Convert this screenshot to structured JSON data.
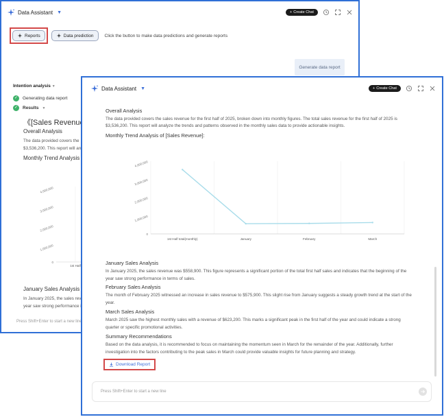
{
  "back": {
    "title": "Data Assistant",
    "create_chat": "Create Chat",
    "reports_button": "Reports",
    "prediction_button": "Data prediction",
    "hint": "Click the button to make data predictions and generate reports",
    "generate_button": "Generate data report",
    "intention_label": "Intention analysis",
    "step_generating": "Generating data report",
    "step_results": "Results",
    "report_title": "《[Sales Revenue] Da",
    "overall_heading": "Overall Analysis",
    "overall_line1": "The data provided covers the",
    "overall_line2": "$3,536,200. This report will an",
    "trend_heading": "Monthly Trend Analysis of",
    "y_ticks": [
      "4,000,000",
      "3,000,000",
      "2,000,000",
      "1,000,000",
      "0"
    ],
    "x_tick": "1st Half",
    "jan_heading": "January Sales Analysis",
    "jan_line1": "In January 2025, the sales reve",
    "jan_line2": "year saw strong performance i",
    "input_placeholder": "Press Shift+Enter to start a new line"
  },
  "front": {
    "title": "Data Assistant",
    "create_chat": "Create Chat",
    "overall_heading": "Overall Analysis",
    "overall_line1": "The data provided covers the sales revenue for the first half of 2025, broken down into monthly figures. The total sales revenue for the first half of 2025 is",
    "overall_line2": "$3,536,200. This report will analyze the trends and patterns observed in the monthly sales data to provide actionable insights.",
    "trend_heading": "Monthly Trend Analysis of [Sales Revenue]:",
    "jan_heading": "January Sales Analysis",
    "jan_line1": "In January 2025, the sales revenue was $558,900. This figure represents a significant portion of the total first half sales and indicates that the beginning of the",
    "jan_line2": "year saw strong performance in terms of sales.",
    "feb_heading": "February Sales Analysis",
    "feb_line1": "The month of February 2025 witnessed an increase in sales revenue to $575,900. This slight rise from January suggests a steady growth trend at the start of the",
    "feb_line2": "year.",
    "mar_heading": "March Sales Analysis",
    "mar_line1": "March 2025 saw the highest monthly sales with a revenue of $623,200. This marks a significant peak in the first half of the year and could indicate a strong",
    "mar_line2": "quarter or specific promotional activities.",
    "sum_heading": "Summary Recommendations",
    "sum_line1": "Based on the data analysis, it is recommended to focus on maintaining the momentum seen in March for the remainder of the year. Additionally, further",
    "sum_line2": "investigation into the factors contributing to the peak sales in March could provide valuable insights for future planning and strategy.",
    "download_label": "Download Report",
    "input_placeholder": "Press Shift+Enter to start a new line"
  },
  "chart_data": {
    "type": "line",
    "categories": [
      "1st Half total(monthly)",
      "January",
      "February",
      "March"
    ],
    "values": [
      3536200,
      558900,
      575900,
      623200
    ],
    "y_ticks": [
      "4,000,000",
      "3,000,000",
      "2,000,000",
      "1,000,000",
      "0"
    ],
    "ylim": [
      0,
      4000000
    ],
    "grid": "vertical",
    "line_color": "#a8dcea"
  }
}
